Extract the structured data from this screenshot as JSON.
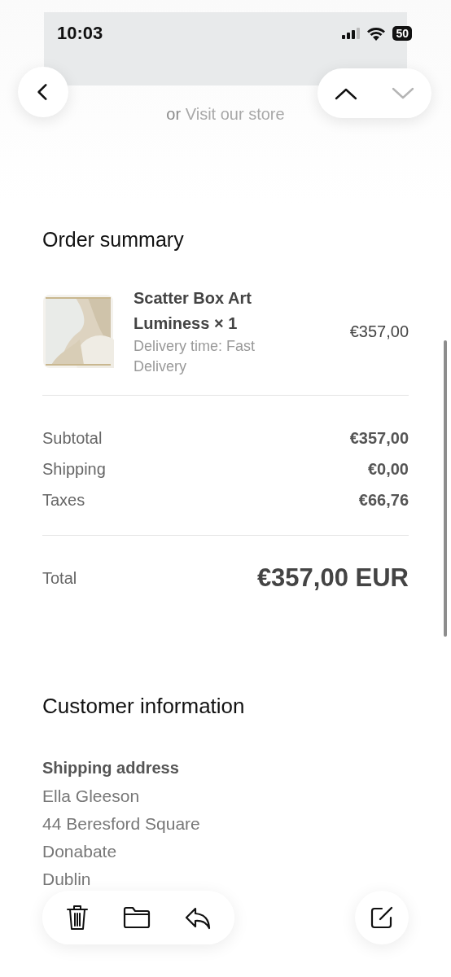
{
  "status_bar": {
    "time": "10:03",
    "battery": "50"
  },
  "store_link": {
    "prefix": "or",
    "link": "Visit our store"
  },
  "order_summary": {
    "title": "Order summary",
    "items": [
      {
        "kind": "picture",
        "name": "Scatter Box Art Luminess × 1",
        "delivery": "Delivery time: Fast Delivery",
        "price": "€357,00"
      }
    ],
    "lines": [
      {
        "label": "Subtotal",
        "value": "€357,00"
      },
      {
        "label": "Shipping",
        "value": "€0,00"
      },
      {
        "label": "Taxes",
        "value": "€66,76"
      }
    ],
    "total": {
      "label": "Total",
      "value": "€357,00 EUR"
    }
  },
  "customer_information": {
    "title": "Customer information",
    "shipping_address": {
      "title": "Shipping address",
      "lines": [
        "Ella Gleeson",
        "44 Beresford Square",
        "Donabate",
        "Dublin"
      ]
    }
  }
}
